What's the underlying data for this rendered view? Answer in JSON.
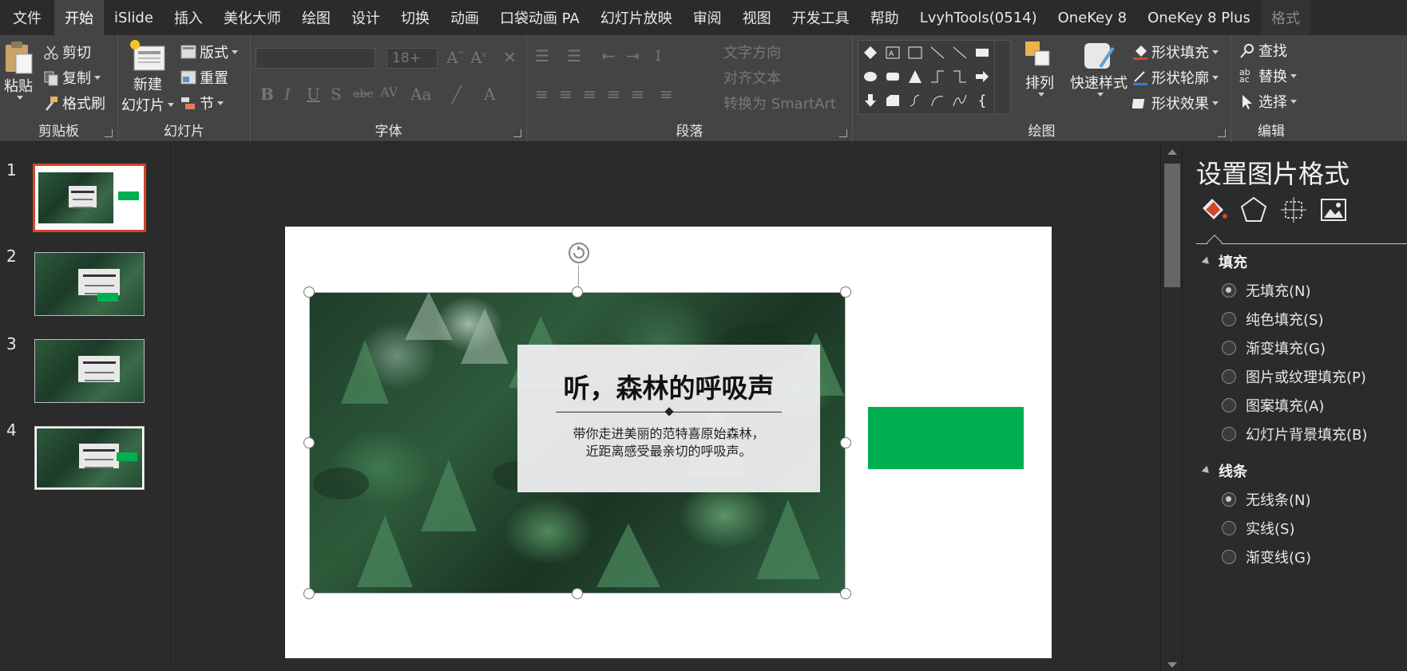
{
  "menu": {
    "file": "文件",
    "tabs": [
      "开始",
      "iSlide",
      "插入",
      "美化大师",
      "绘图",
      "设计",
      "切换",
      "动画",
      "口袋动画 PA",
      "幻灯片放映",
      "审阅",
      "视图",
      "开发工具",
      "帮助",
      "LvyhTools(0514)",
      "OneKey 8",
      "OneKey 8 Plus"
    ],
    "active_tab": "开始",
    "context_tab": "格式"
  },
  "ribbon": {
    "clipboard": {
      "label": "剪贴板",
      "paste": "粘贴",
      "cut": "剪切",
      "copy": "复制",
      "format_painter": "格式刷"
    },
    "slides": {
      "label": "幻灯片",
      "new_slide_line1": "新建",
      "new_slide_line2": "幻灯片",
      "layout": "版式",
      "reset": "重置",
      "section": "节"
    },
    "font": {
      "label": "字体",
      "font_name": "",
      "font_size": "18+"
    },
    "paragraph": {
      "label": "段落",
      "text_direction": "文字方向",
      "align_text": "对齐文本",
      "convert_smartart": "转换为 SmartArt"
    },
    "drawing": {
      "label": "绘图",
      "arrange": "排列",
      "quick_styles": "快速样式",
      "shape_fill": "形状填充",
      "shape_outline": "形状轮廓",
      "shape_effects": "形状效果"
    },
    "editing": {
      "label": "编辑",
      "find": "查找",
      "replace": "替换",
      "select": "选择"
    }
  },
  "thumbnails": [
    {
      "number": "1",
      "selected": true
    },
    {
      "number": "2",
      "selected": false
    },
    {
      "number": "3",
      "selected": false
    },
    {
      "number": "4",
      "selected": false
    }
  ],
  "slide": {
    "title": "听，森林的呼吸声",
    "subtitle_line1": "带你走进美丽的范特喜原始森林，",
    "subtitle_line2": "近距离感受最亲切的呼吸声。",
    "accent_color": "#00b050"
  },
  "format_pane": {
    "title": "设置图片格式",
    "icons": [
      "fill-line-icon",
      "effects-pentagon-icon",
      "size-properties-icon",
      "picture-icon"
    ],
    "fill": {
      "heading": "填充",
      "options": [
        "无填充(N)",
        "纯色填充(S)",
        "渐变填充(G)",
        "图片或纹理填充(P)",
        "图案填充(A)",
        "幻灯片背景填充(B)"
      ],
      "selected_index": 0
    },
    "line": {
      "heading": "线条",
      "options": [
        "无线条(N)",
        "实线(S)",
        "渐变线(G)"
      ],
      "selected_index": 0
    }
  },
  "colors": {
    "selection_border": "#d24726",
    "ribbon_bg": "#444444",
    "app_bg": "#2b2b2b"
  }
}
